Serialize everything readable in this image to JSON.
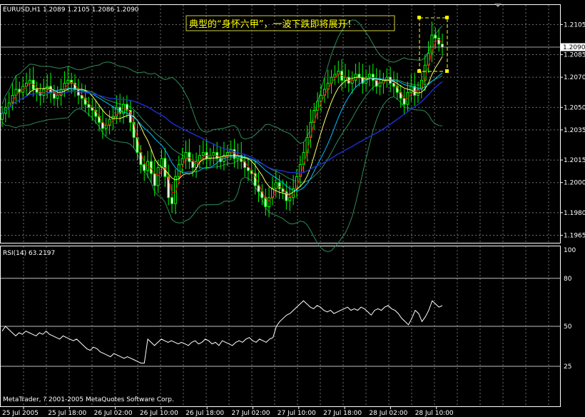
{
  "window": {
    "symbol_info": "EURUSD,H1  1.2089 1.2105 1.2086 1.2090",
    "annotation": "典型的“身怀六甲”，一波下跌即将展开！",
    "copyright": "MetaTrader, ? 2001-2005 MetaQuotes Software Corp."
  },
  "chart_data": [
    {
      "type": "candlestick",
      "symbol": "EURUSD",
      "timeframe": "H1",
      "ohlc_current": {
        "open": 1.2089,
        "high": 1.2105,
        "low": 1.2086,
        "close": 1.209
      },
      "current_price_label": "1.2090",
      "y_tick_labels": [
        "1.2105",
        "1.2085",
        "1.2070",
        "1.2050",
        "1.2035",
        "1.2015",
        "1.2000",
        "1.1980",
        "1.1965"
      ],
      "ylim": [
        1.196,
        1.2118
      ],
      "x_tick_labels": [
        "25 Jul 2005",
        "25 Jul 18:00",
        "26 Jul 02:00",
        "26 Jul 10:00",
        "26 Jul 18:00",
        "27 Jul 02:00",
        "27 Jul 10:00",
        "27 Jul 18:00",
        "28 Jul 02:00",
        "28 Jul 10:00"
      ],
      "grid": true,
      "colors": {
        "bull_body": "#000000",
        "bear_body": "#ffffff",
        "wick": "#00ff00",
        "bollinger": "#2e8b57",
        "ma_fast": "#ff0000",
        "ma_mid": "#ffff66",
        "ma_slow": "#00bfff",
        "ma_long": "#1e2fd0"
      },
      "closes": [
        1.2046,
        1.205,
        1.2053,
        1.2058,
        1.2062,
        1.206,
        1.2064,
        1.2066,
        1.2068,
        1.2062,
        1.206,
        1.2058,
        1.2062,
        1.2064,
        1.206,
        1.2056,
        1.2058,
        1.2062,
        1.2066,
        1.2068,
        1.2066,
        1.2062,
        1.2058,
        1.2056,
        1.2052,
        1.205,
        1.2048,
        1.2044,
        1.204,
        1.2036,
        1.2038,
        1.2042,
        1.2044,
        1.205,
        1.2046,
        1.2052,
        1.2048,
        1.204,
        1.203,
        1.202,
        1.2012,
        1.2008,
        1.2014,
        1.2006,
        1.1998,
        1.201,
        1.2016,
        1.2004,
        1.199,
        1.1986,
        1.2004,
        1.2012,
        1.2016,
        1.202,
        1.2014,
        1.201,
        1.2014,
        1.2018,
        1.202,
        1.2016,
        1.2018,
        1.202,
        1.2016,
        1.2014,
        1.2018,
        1.202,
        1.2022,
        1.2016,
        1.2018,
        1.2014,
        1.201,
        1.2008,
        1.2006,
        1.1998,
        1.1994,
        1.199,
        1.1984,
        1.199,
        1.1996,
        1.2,
        1.1996,
        1.1994,
        1.1988,
        1.199,
        1.1996,
        1.2004,
        1.2012,
        1.202,
        1.203,
        1.204,
        1.2048,
        1.2054,
        1.2058,
        1.2062,
        1.2066,
        1.207,
        1.2072,
        1.2074,
        1.2068,
        1.207,
        1.2066,
        1.2068,
        1.2072,
        1.207,
        1.2066,
        1.207,
        1.2072,
        1.2068,
        1.2064,
        1.2066,
        1.2068,
        1.207,
        1.2066,
        1.2064,
        1.206,
        1.2056,
        1.2052,
        1.206,
        1.2064,
        1.2058,
        1.2062,
        1.2068,
        1.2078,
        1.2086,
        1.2098,
        1.2096,
        1.2092,
        1.209
      ]
    },
    {
      "type": "line",
      "indicator_label": "RSI(14) 63.2197",
      "y_tick_labels": [
        "100",
        "80",
        "50",
        "25"
      ],
      "ylim": [
        0,
        100
      ],
      "levels": [
        80,
        50,
        25
      ],
      "values": [
        47,
        50,
        48,
        46,
        44,
        46,
        45,
        47,
        46,
        45,
        44,
        46,
        45,
        47,
        45,
        44,
        43,
        42,
        44,
        43,
        42,
        41,
        42,
        40,
        38,
        36,
        35,
        37,
        36,
        34,
        33,
        32,
        31,
        33,
        32,
        31,
        30,
        31,
        30,
        29,
        28,
        27,
        27,
        42,
        40,
        38,
        40,
        42,
        41,
        40,
        41,
        40,
        39,
        40,
        39,
        38,
        40,
        41,
        39,
        40,
        42,
        41,
        39,
        40,
        38,
        41,
        40,
        39,
        38,
        40,
        41,
        40,
        42,
        43,
        41,
        40,
        42,
        41,
        40,
        42,
        43,
        50,
        53,
        55,
        57,
        58,
        60,
        62,
        64,
        66,
        64,
        62,
        61,
        63,
        62,
        60,
        59,
        60,
        58,
        59,
        60,
        61,
        62,
        60,
        61,
        60,
        62,
        61,
        59,
        57,
        60,
        61,
        60,
        62,
        63,
        61,
        60,
        58,
        55,
        53,
        51,
        55,
        60,
        58,
        53,
        56,
        60,
        66,
        64,
        62,
        63
      ]
    }
  ]
}
